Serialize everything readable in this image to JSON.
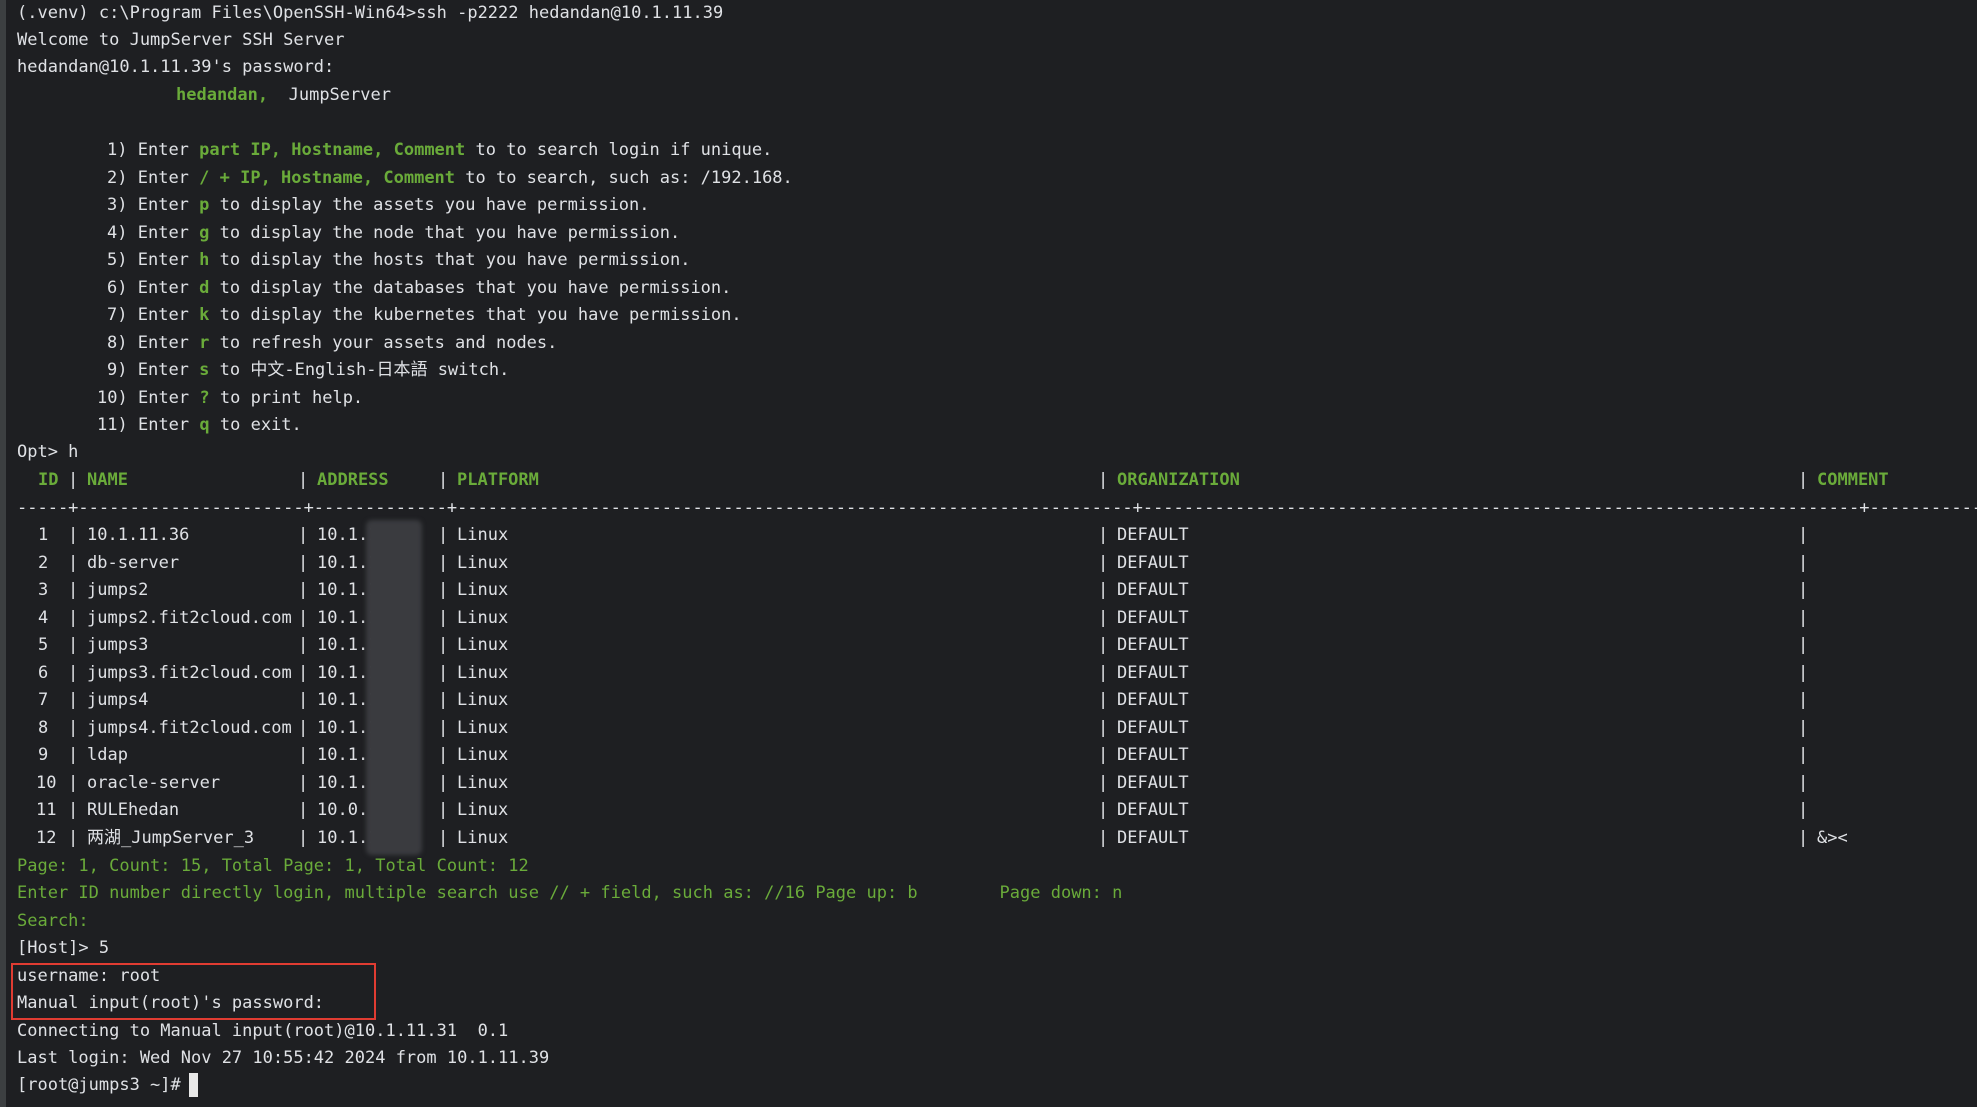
{
  "terminal": {
    "cmd_line": "(.venv) c:\\Program Files\\OpenSSH-Win64>ssh -p2222 hedandan@10.1.11.39",
    "welcome": "Welcome to JumpServer SSH Server",
    "password_prompt": "hedandan@10.1.11.39's password:",
    "greeting_user": "hedandan,",
    "greeting_app": "JumpServer",
    "menu": [
      {
        "num": "1)",
        "pre": "Enter ",
        "key": "part IP, Hostname, Comment",
        "post": " to to search login if unique."
      },
      {
        "num": "2)",
        "pre": "Enter ",
        "key": "/ + IP, Hostname, Comment",
        "post": " to to search, such as: /192.168."
      },
      {
        "num": "3)",
        "pre": "Enter ",
        "key": "p",
        "post": " to display the assets you have permission."
      },
      {
        "num": "4)",
        "pre": "Enter ",
        "key": "g",
        "post": " to display the node that you have permission."
      },
      {
        "num": "5)",
        "pre": "Enter ",
        "key": "h",
        "post": " to display the hosts that you have permission."
      },
      {
        "num": "6)",
        "pre": "Enter ",
        "key": "d",
        "post": " to display the databases that you have permission."
      },
      {
        "num": "7)",
        "pre": "Enter ",
        "key": "k",
        "post": " to display the kubernetes that you have permission."
      },
      {
        "num": "8)",
        "pre": "Enter ",
        "key": "r",
        "post": " to refresh your assets and nodes."
      },
      {
        "num": "9)",
        "pre": "Enter ",
        "key": "s",
        "post": " to 中文-English-日本語 switch."
      },
      {
        "num": "10)",
        "pre": "Enter ",
        "key": "?",
        "post": " to print help."
      },
      {
        "num": "11)",
        "pre": "Enter ",
        "key": "q",
        "post": " to exit."
      }
    ],
    "opt_prompt": "Opt> h",
    "table": {
      "headers": [
        "ID",
        "NAME",
        "ADDRESS",
        "PLATFORM",
        "ORGANIZATION",
        "COMMENT"
      ],
      "separator": "-----+----------------------+-------------+------------------------------------------------------------------+----------------------------------------------------------------------+------------------",
      "rows": [
        {
          "id": "1",
          "name": "10.1.11.36",
          "address": "10.1.11",
          "platform": "Linux",
          "org": "DEFAULT",
          "comment": ""
        },
        {
          "id": "2",
          "name": "db-server",
          "address": "10.1.11",
          "platform": "Linux",
          "org": "DEFAULT",
          "comment": ""
        },
        {
          "id": "3",
          "name": "jumps2",
          "address": "10.1.11",
          "platform": "Linux",
          "org": "DEFAULT",
          "comment": ""
        },
        {
          "id": "4",
          "name": "jumps2.fit2cloud.com",
          "address": "10.1.11",
          "platform": "Linux",
          "org": "DEFAULT",
          "comment": ""
        },
        {
          "id": "5",
          "name": "jumps3",
          "address": "10.1.11",
          "platform": "Linux",
          "org": "DEFAULT",
          "comment": ""
        },
        {
          "id": "6",
          "name": "jumps3.fit2cloud.com",
          "address": "10.1.11",
          "platform": "Linux",
          "org": "DEFAULT",
          "comment": ""
        },
        {
          "id": "7",
          "name": "jumps4",
          "address": "10.1.1",
          "platform": "Linux",
          "org": "DEFAULT",
          "comment": ""
        },
        {
          "id": "8",
          "name": "jumps4.fit2cloud.com",
          "address": "10.1.1",
          "platform": "Linux",
          "org": "DEFAULT",
          "comment": ""
        },
        {
          "id": "9",
          "name": "ldap",
          "address": "10.1.1",
          "platform": "Linux",
          "org": "DEFAULT",
          "comment": ""
        },
        {
          "id": "10",
          "name": "oracle-server",
          "address": "10.1.",
          "platform": "Linux",
          "org": "DEFAULT",
          "comment": ""
        },
        {
          "id": "11",
          "name": "RULEhedan",
          "address": "10.0.",
          "platform": "Linux",
          "org": "DEFAULT",
          "comment": ""
        },
        {
          "id": "12",
          "name": "两湖_JumpServer_3",
          "address": "10.1.1",
          "platform": "Linux",
          "org": "DEFAULT",
          "comment": "&><"
        }
      ]
    },
    "page_info": "Page: 1, Count: 15, Total Page: 1, Total Count: 12",
    "hint_line": "Enter ID number directly login, multiple search use // + field, such as: //16 Page up: b        Page down: n",
    "search_label": "Search:",
    "host_prompt": "[Host]> 5",
    "username_line": "username: root",
    "manual_pw_line": "Manual input(root)'s password:",
    "connecting_line": "Connecting to Manual input(root)@10.1.11.31  0.1",
    "last_login_line": "Last login: Wed Nov 27 10:55:42 2024 from 10.1.11.39",
    "shell_prompt": "[root@jumps3 ~]#"
  }
}
